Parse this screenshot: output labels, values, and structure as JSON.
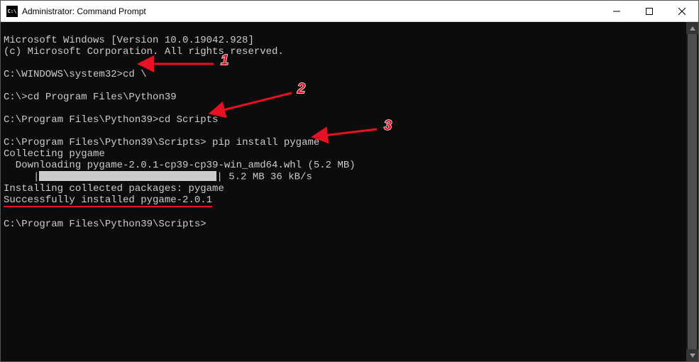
{
  "titlebar": {
    "icon_text": "C:\\",
    "title": "Administrator: Command Prompt"
  },
  "terminal": {
    "line_version": "Microsoft Windows [Version 10.0.19042.928]",
    "line_copyright": "(c) Microsoft Corporation. All rights reserved.",
    "blank1": "",
    "prompt1": "C:\\WINDOWS\\system32>",
    "cmd1": "cd \\",
    "blank2": "",
    "prompt2": "C:\\>",
    "cmd2": "cd Program Files\\Python39",
    "blank3": "",
    "prompt3": "C:\\Program Files\\Python39>",
    "cmd3": "cd Scripts",
    "blank4": "",
    "prompt4": "C:\\Program Files\\Python39\\Scripts>",
    "cmd4": " pip install pygame",
    "out_collecting": "Collecting pygame",
    "out_downloading": "  Downloading pygame-2.0.1-cp39-cp39-win_amd64.whl (5.2 MB)",
    "out_progress_prefix": "     |",
    "out_progress_suffix": "| 5.2 MB 36 kB/s",
    "out_installing": "Installing collected packages: pygame",
    "out_success": "Successfully installed pygame-2.0.1",
    "blank5": "",
    "prompt5": "C:\\Program Files\\Python39\\Scripts>",
    "cursor": ""
  },
  "annotations": {
    "label1": "1",
    "label2": "2",
    "label3": "3"
  }
}
